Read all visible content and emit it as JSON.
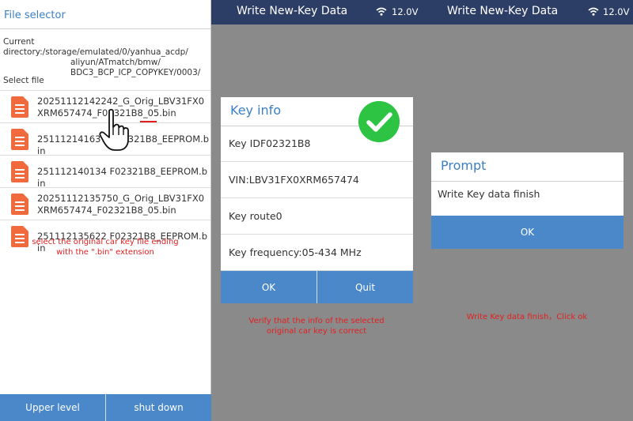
{
  "file_selector": {
    "title": "File selector",
    "current_dir_line1": "Current directory:/storage/emulated/0/yanhua_acdp/",
    "current_dir_line2": "aliyun/ATmatch/bmw/",
    "current_dir_line3": "BDC3_BCP_ICP_COPYKEY/0003/",
    "select_label": "Select file",
    "files": [
      {
        "name": "20251112142242_G_Orig_LBV31FX0XRM657474_F02321B8_05.bin",
        "icon": "file-icon"
      },
      {
        "name": "251112141637_F02321B8_EEPROM.bin",
        "icon": "file-icon"
      },
      {
        "name": "251112140134 F02321B8_EEPROM.bin",
        "icon": "file-icon"
      },
      {
        "name": "20251112135750_G_Orig_LBV31FX0XRM657474_F02321B8_05.bin",
        "icon": "file-icon"
      },
      {
        "name": "251112135622 F02321B8_EEPROM.bin",
        "icon": "file-icon"
      }
    ],
    "annotation": "select the original car key file ending with the \".bin\" extension",
    "buttons": {
      "upper_level": "Upper level",
      "shut_down": "shut down"
    }
  },
  "key_info_screen": {
    "header_title": "Write New-Key Data",
    "voltage": "12.0V",
    "dialog_title": "Key info",
    "rows": [
      "Key IDF02321B8",
      "VIN:LBV31FX0XRM657474",
      "Key route0",
      "Key frequency:05-434 MHz"
    ],
    "ok_label": "OK",
    "quit_label": "Quit",
    "annotation": "Verify that the info of the selected original car key is correct"
  },
  "prompt_screen": {
    "header_title": "Write New-Key Data",
    "voltage": "12.0V",
    "dialog_title": "Prompt",
    "message": "Write Key data finish",
    "ok_label": "OK",
    "annotation": "Write Key data finish，Click ok"
  },
  "colors": {
    "header_bg": "#2d3e66",
    "accent_blue": "#4a88c9",
    "title_blue": "#3b7fc4",
    "annotation_red": "#e41f1f",
    "check_green": "#2dc443",
    "file_icon_orange": "#f06a3d"
  }
}
